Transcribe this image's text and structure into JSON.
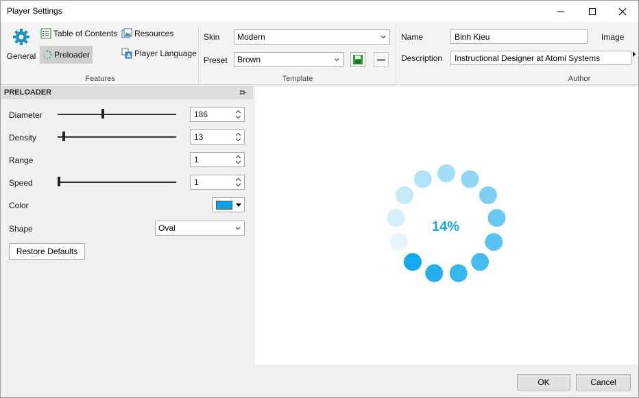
{
  "window": {
    "title": "Player Settings"
  },
  "titlebar": {
    "minimize": "—",
    "maximize": "☐",
    "close": "✕"
  },
  "features": {
    "group_label": "Features",
    "general": "General",
    "table_of_contents": "Table of Contents",
    "resources": "Resources",
    "preloader": "Preloader",
    "player_language": "Player Language"
  },
  "template": {
    "group_label": "Template",
    "skin_label": "Skin",
    "skin_value": "Modern",
    "preset_label": "Preset",
    "preset_value": "Brown"
  },
  "author": {
    "group_label": "Author",
    "name_label": "Name",
    "name_value": "Binh Kieu",
    "image_label": "Image",
    "description_label": "Description",
    "description_value": "Instructional Designer at Atomi Systems"
  },
  "panel": {
    "header": "PRELOADER",
    "diameter_label": "Diameter",
    "diameter_value": "186",
    "diameter_level": 0.38,
    "density_label": "Density",
    "density_value": "13",
    "density_level": 0.04,
    "range_label": "Range",
    "range_value": "1",
    "speed_label": "Speed",
    "speed_value": "1",
    "speed_level": 0.0,
    "color_label": "Color",
    "color_value": "#00a2e8",
    "shape_label": "Shape",
    "shape_value": "Oval",
    "restore_label": "Restore Defaults"
  },
  "preview": {
    "percent": "14%",
    "color": "#12aaec"
  },
  "footer": {
    "ok": "OK",
    "cancel": "Cancel"
  }
}
